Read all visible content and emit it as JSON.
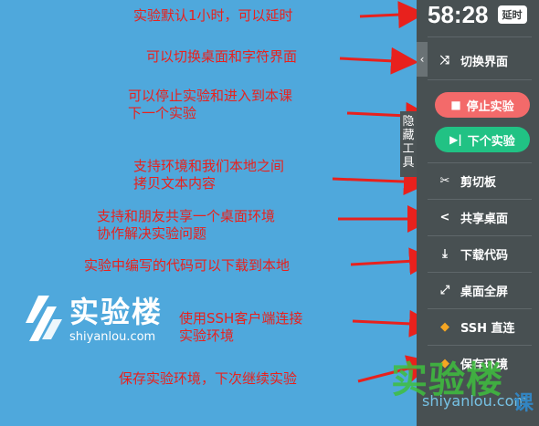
{
  "annotations": [
    "实验默认1小时，可以延时",
    "可以切换桌面和字符界面",
    "可以停止实验和进入到本课",
    "下一个实验",
    "支持环境和我们本地之间",
    "拷贝文本内容",
    "支持和朋友共享一个桌面环境",
    "协作解决实验问题",
    "实验中编写的代码可以下载到本地",
    "使用SSH客户端连接",
    "实验环境",
    "保存实验环境，下次继续实验"
  ],
  "logo": {
    "name": "实验楼",
    "url": "shiyanlou.com"
  },
  "hide_tab": "隐藏工具",
  "toolbar": {
    "timer": "58:28",
    "extend_label": "延时",
    "switch_label": "切换界面",
    "stop_label": "停止实验",
    "next_label": "下个实验",
    "clipboard_label": "剪切板",
    "share_label": "共享桌面",
    "download_label": "下载代码",
    "fullscreen_label": "桌面全屏",
    "ssh_label": "SSH 直连",
    "save_label": "保存环境"
  },
  "watermark": {
    "name": "实验楼",
    "url": "shiyanlou.com",
    "suffix": "课"
  },
  "colors": {
    "desktop": "#4fa8dc",
    "toolbar": "#485052",
    "stop": "#f36a6a",
    "next": "#21c284",
    "annotation": "#e8211d"
  },
  "icons": [
    "shuffle-icon",
    "stop-square-icon",
    "skip-next-icon",
    "scissors-icon",
    "share-icon",
    "download-icon",
    "fullscreen-icon",
    "diamond-icon",
    "collapse-chevron-icon"
  ]
}
